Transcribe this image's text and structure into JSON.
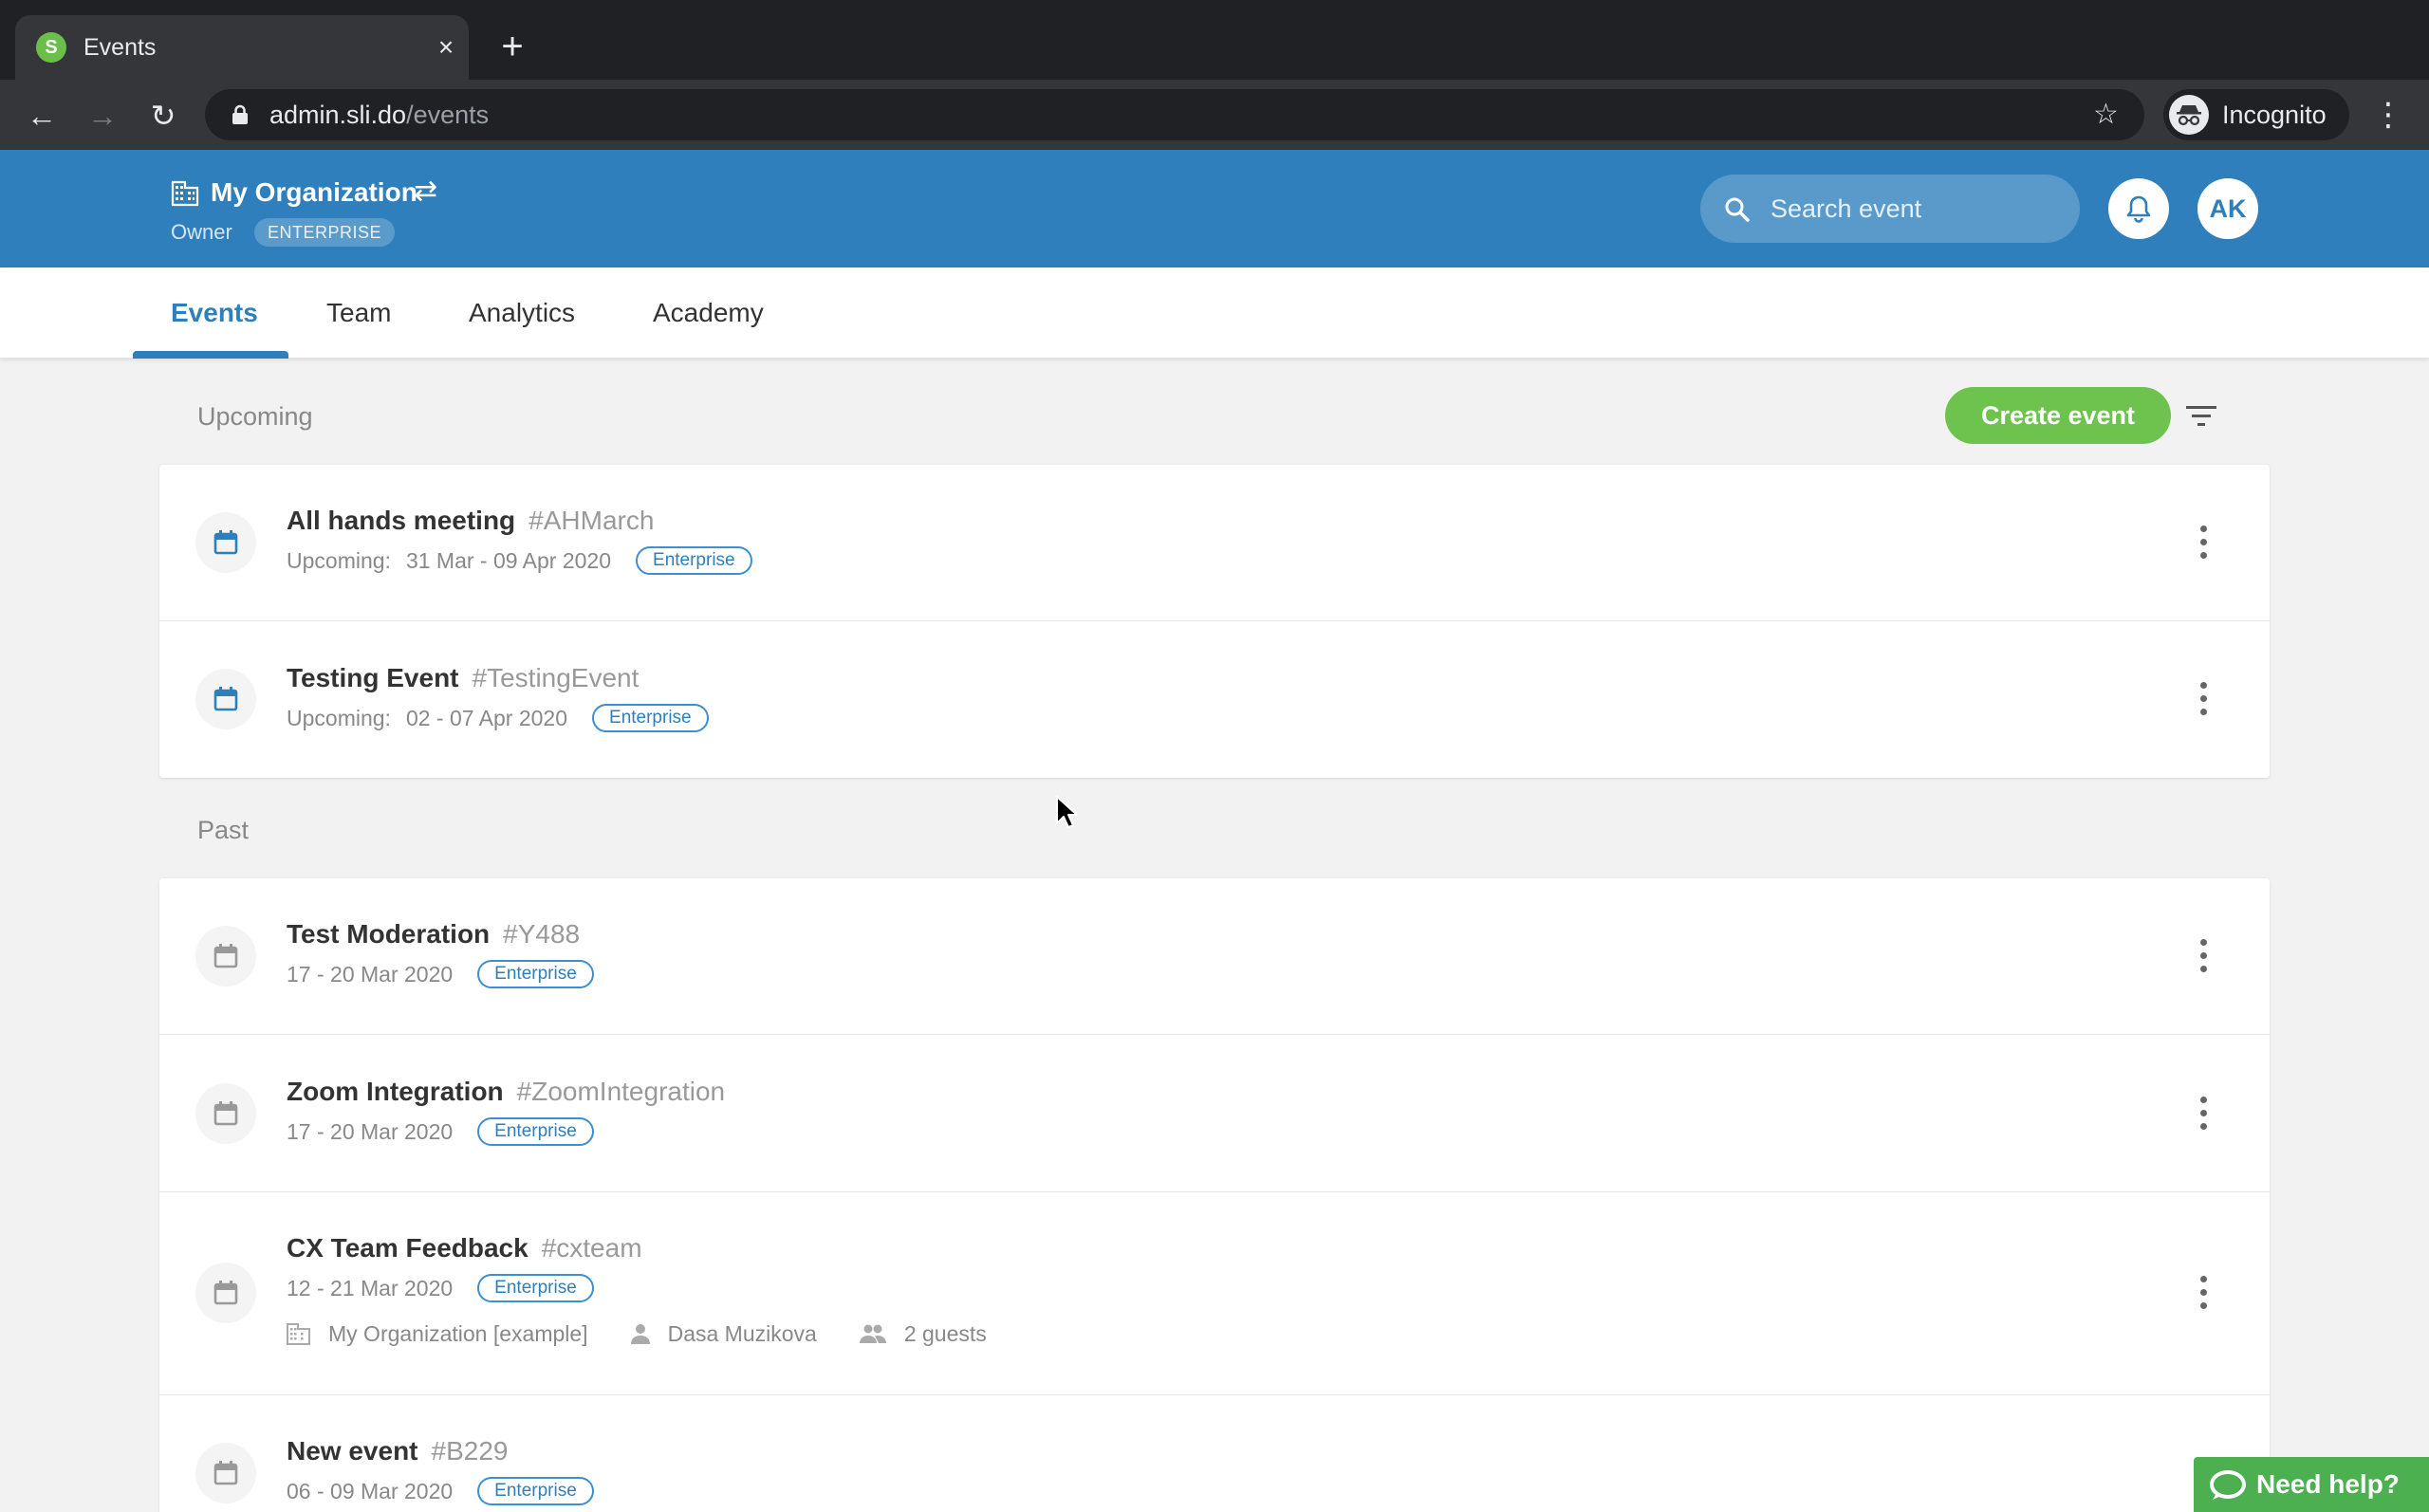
{
  "browser": {
    "tab_title": "Events",
    "tab_favicon_letter": "S",
    "url_host": "admin.sli.do",
    "url_path": "/events",
    "incognito_label": "Incognito"
  },
  "header": {
    "org_name": "My Organization",
    "role": "Owner",
    "plan": "ENTERPRISE",
    "search_placeholder": "Search event",
    "avatar_initials": "AK",
    "brand_color": "#2f7fbc"
  },
  "nav": {
    "tabs": [
      {
        "label": "Events",
        "active": true
      },
      {
        "label": "Team",
        "active": false
      },
      {
        "label": "Analytics",
        "active": false
      },
      {
        "label": "Academy",
        "active": false
      }
    ]
  },
  "actions": {
    "create_event": "Create event",
    "create_color": "#6ec24e"
  },
  "sections": {
    "upcoming": {
      "title": "Upcoming",
      "events": [
        {
          "name": "All hands meeting",
          "code": "#AHMarch",
          "status": "Upcoming:",
          "dates": "31 Mar - 09 Apr 2020",
          "badge": "Enterprise"
        },
        {
          "name": "Testing Event",
          "code": "#TestingEvent",
          "status": "Upcoming:",
          "dates": "02 - 07 Apr 2020",
          "badge": "Enterprise"
        }
      ]
    },
    "past": {
      "title": "Past",
      "events": [
        {
          "name": "Test Moderation",
          "code": "#Y488",
          "dates": "17 - 20 Mar 2020",
          "badge": "Enterprise"
        },
        {
          "name": "Zoom Integration",
          "code": "#ZoomIntegration",
          "dates": "17 - 20 Mar 2020",
          "badge": "Enterprise"
        },
        {
          "name": "CX Team Feedback",
          "code": "#cxteam",
          "dates": "12 - 21 Mar 2020",
          "badge": "Enterprise",
          "org": "My Organization [example]",
          "owner": "Dasa Muzikova",
          "guests": "2 guests"
        },
        {
          "name": "New event",
          "code": "#B229",
          "dates": "06 - 09 Mar 2020",
          "badge": "Enterprise"
        }
      ]
    }
  },
  "help": {
    "label": "Need help?"
  }
}
